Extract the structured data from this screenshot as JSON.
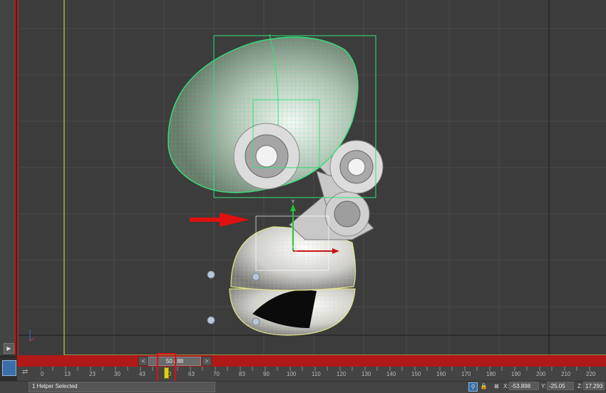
{
  "viewport": {
    "gizmo_x_label": "",
    "gizmo_y_label": "Y"
  },
  "timeline": {
    "frame_indicator": "50 / 88",
    "prev_label": "<",
    "next_label": ">",
    "current_frame_label": "50",
    "ticks": [
      "0",
      "13",
      "23",
      "30",
      "43",
      "50",
      "63",
      "70",
      "83",
      "90",
      "100",
      "110",
      "120",
      "130",
      "140",
      "150",
      "160",
      "170",
      "180",
      "190",
      "200",
      "210",
      "220"
    ]
  },
  "status": {
    "prompt": "1 Helper Selected",
    "x_label": "X:",
    "x_value": "-53.898",
    "y_label": "Y:",
    "y_value": "-25.05",
    "z_label": "Z:",
    "z_value": "17.293"
  },
  "colors": {
    "viewport_bg": "#3c3c3c",
    "selection_green": "#35e07a",
    "wire_yellow": "#e6e68a",
    "timeslider_red": "#b11818",
    "arrow_red": "#e01010"
  },
  "icons": [
    "expand-icon",
    "set-key-icon",
    "track-icon",
    "lock-icon",
    "isolate-icon",
    "selection-lock-icon",
    "absolute-mode-icon",
    "gizmo-axis-icon",
    "red-arrow-icon"
  ]
}
